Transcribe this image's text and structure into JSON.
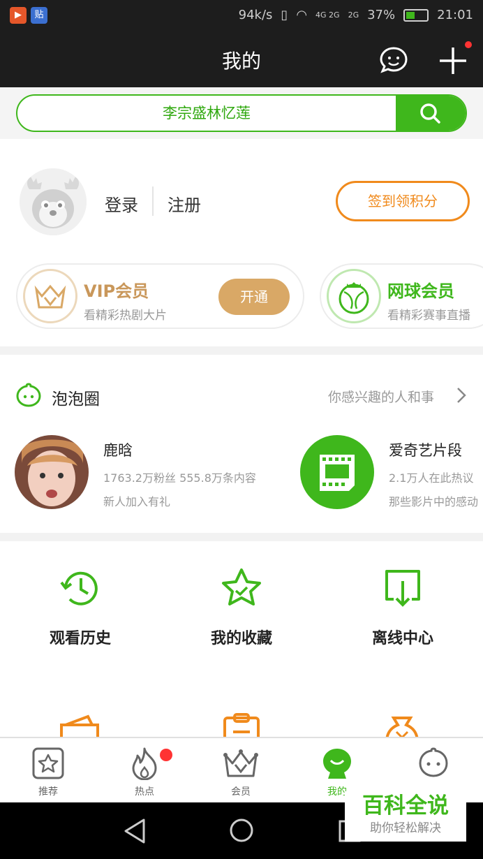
{
  "status_bar": {
    "speed": "94k/s",
    "network1": "4G 2G",
    "network2": "2G",
    "battery": "37%",
    "time": "21:01",
    "app_badge": "贴"
  },
  "header": {
    "title": "我的"
  },
  "search": {
    "query": "李宗盛林忆莲"
  },
  "profile": {
    "login": "登录",
    "register": "注册",
    "sign_in": "签到领积分"
  },
  "vip_card": {
    "title": "VIP会员",
    "subtitle": "看精彩热剧大片",
    "button": "开通"
  },
  "tennis_card": {
    "title": "网球会员",
    "subtitle": "看精彩赛事直播"
  },
  "bubble": {
    "title": "泡泡圈",
    "more": "你感兴趣的人和事",
    "people": [
      {
        "name": "鹿晗",
        "line1": "1763.2万粉丝  555.8万条内容",
        "line2": "新人加入有礼"
      },
      {
        "name": "爱奇艺片段",
        "line1": "2.1万人在此热议",
        "line2": "那些影片中的感动"
      }
    ]
  },
  "quick": [
    {
      "label": "观看历史",
      "icon": "history-icon"
    },
    {
      "label": "我的收藏",
      "icon": "star-icon"
    },
    {
      "label": "离线中心",
      "icon": "download-icon"
    }
  ],
  "nav": [
    {
      "label": "推荐"
    },
    {
      "label": "热点"
    },
    {
      "label": "会员"
    },
    {
      "label": "我的"
    },
    {
      "label": ""
    }
  ],
  "watermark": {
    "title": "百科全说",
    "subtitle": "助你轻松解决"
  },
  "colors": {
    "accent": "#3fb71c",
    "orange": "#f08a1c",
    "vip_gold": "#d9a866",
    "dark_bar": "#1d1d1d"
  }
}
